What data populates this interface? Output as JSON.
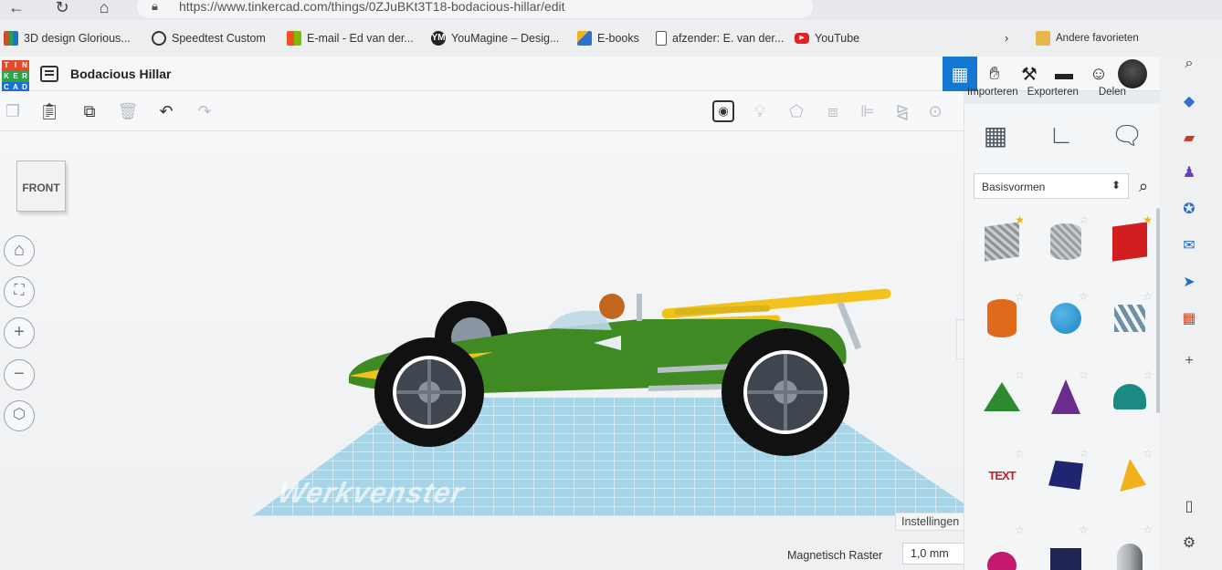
{
  "browser": {
    "url": "https://www.tinkercad.com/things/0ZJuBKt3T18-bodacious-hillar/edit",
    "bookmarks": [
      {
        "label": "3D design Glorious...",
        "icon": "tinkercad-grid-icon",
        "color": "#d04b2b"
      },
      {
        "label": "Speedtest Custom",
        "icon": "speedometer-icon",
        "color": "#333333"
      },
      {
        "label": "E-mail - Ed van der...",
        "icon": "microsoft-icon",
        "color": "#f25022"
      },
      {
        "label": "YouMagine – Desig...",
        "icon": "youmagine-icon",
        "color": "#222222"
      },
      {
        "label": "E-books",
        "icon": "ebooks-icon",
        "color": "#2f6fd1"
      },
      {
        "label": "afzender: E. van der...",
        "icon": "document-icon",
        "color": "#666666"
      },
      {
        "label": "YouTube",
        "icon": "youtube-icon",
        "color": "#e22222"
      }
    ],
    "other_favorites": "Andere favorieten"
  },
  "app": {
    "logo_letters": [
      "T",
      "I",
      "N",
      "K",
      "E",
      "R",
      "C",
      "A",
      "D"
    ],
    "design_title": "Bodacious Hillar",
    "actions": {
      "import": "Importeren",
      "export": "Exporteren",
      "share": "Delen"
    },
    "viewcube_face": "FRONT",
    "workplane_label": "Werkvenster",
    "settings_label": "Instellingen",
    "snap_label": "Magnetisch Raster",
    "snap_value": "1,0 mm",
    "library_selected": "Basisvormen"
  },
  "colors": {
    "accent": "#1477d1",
    "car_body": "#3f8a23",
    "car_trim": "#f2c21b",
    "workplane": "#a7d4e6"
  },
  "shapes": [
    {
      "name": "box-hole",
      "color": "#8f9296",
      "starred": true
    },
    {
      "name": "cylinder-hole",
      "color": "#9a9da1",
      "starred": false
    },
    {
      "name": "box",
      "color": "#d11f1f",
      "starred": true
    },
    {
      "name": "cylinder",
      "color": "#e06a1c",
      "starred": false
    },
    {
      "name": "sphere",
      "color": "#1a86c7",
      "starred": false
    },
    {
      "name": "scribble",
      "color": "#6f8fa3",
      "starred": false
    },
    {
      "name": "pyramid-green",
      "color": "#2f8a2f",
      "starred": false
    },
    {
      "name": "cone",
      "color": "#6a2c8f",
      "starred": false
    },
    {
      "name": "roof",
      "color": "#1a8a82",
      "starred": false
    },
    {
      "name": "text",
      "color": "#c1232b",
      "starred": false
    },
    {
      "name": "polygon",
      "color": "#1f2570",
      "starred": false
    },
    {
      "name": "pyramid-yellow",
      "color": "#f0b21b",
      "starred": false
    },
    {
      "name": "half-sphere",
      "color": "#c41a6e",
      "starred": false
    },
    {
      "name": "prism",
      "color": "#1f2455",
      "starred": false
    },
    {
      "name": "paraboloid",
      "color": "#a9acb0",
      "starred": false
    }
  ],
  "shape_text_label": "TEXT"
}
